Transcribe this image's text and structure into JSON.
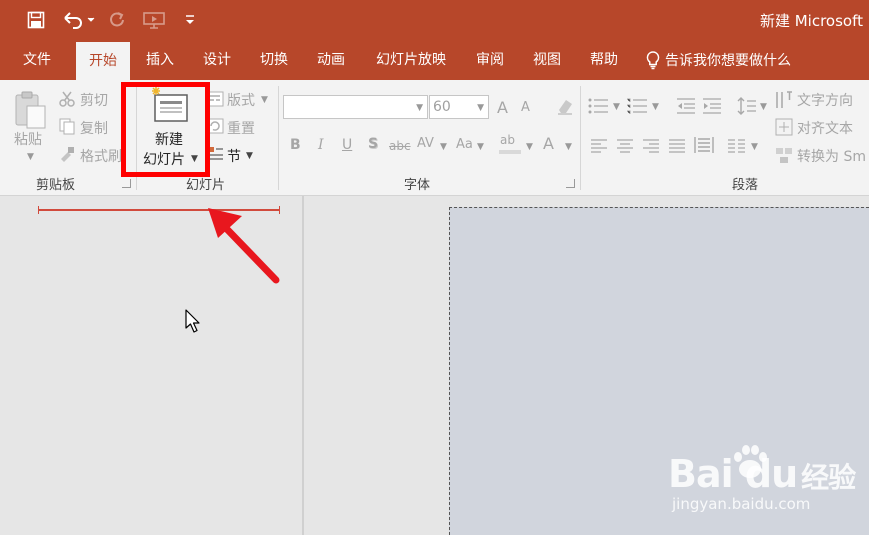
{
  "titlebar": {
    "window_title": "新建 Microsoft"
  },
  "tabs": [
    {
      "label": "文件"
    },
    {
      "label": "开始"
    },
    {
      "label": "插入"
    },
    {
      "label": "设计"
    },
    {
      "label": "切换"
    },
    {
      "label": "动画"
    },
    {
      "label": "幻灯片放映"
    },
    {
      "label": "审阅"
    },
    {
      "label": "视图"
    },
    {
      "label": "帮助"
    }
  ],
  "tellme": {
    "label": "告诉我你想要做什么"
  },
  "clipboard": {
    "paste": "粘贴",
    "cut": "剪切",
    "copy": "复制",
    "format_painter": "格式刷",
    "group_label": "剪贴板"
  },
  "slides": {
    "new_slide_line1": "新建",
    "new_slide_line2": "幻灯片",
    "layout": "版式",
    "reset": "重置",
    "section": "节",
    "group_label": "幻灯片"
  },
  "font": {
    "font_name_value": "",
    "font_size_value": "60",
    "grow_label": "A",
    "shrink_label": "A",
    "bold": "B",
    "italic": "I",
    "underline": "U",
    "shadow": "S",
    "strikethrough": "abc",
    "spacing": "AV",
    "change_case": "Aa",
    "font_color": "A",
    "highlight": "ab",
    "group_label": "字体"
  },
  "paragraph": {
    "text_direction": "文字方向",
    "align_text": "对齐文本",
    "convert_smartart": "转换为 Sm",
    "group_label": "段落"
  },
  "watermark": {
    "brand": "Bai du",
    "chinese": "经验",
    "url": "jingyan.baidu.com"
  },
  "colors": {
    "accent": "#b7472a",
    "highlight_box": "#ff0000",
    "arrow": "#e8171e",
    "slide_bg": "#d1d5dd"
  }
}
